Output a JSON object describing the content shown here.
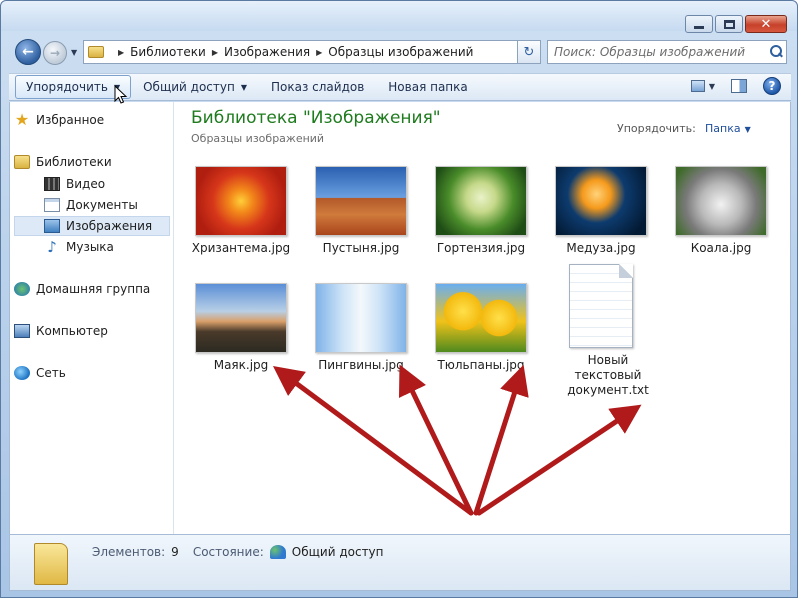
{
  "address": {
    "crumbs": [
      "Библиотеки",
      "Изображения",
      "Образцы изображений"
    ]
  },
  "search": {
    "placeholder": "Поиск: Образцы изображений"
  },
  "toolbar": {
    "organize": "Упорядочить",
    "share": "Общий доступ",
    "slideshow": "Показ слайдов",
    "new_folder": "Новая папка"
  },
  "nav": {
    "favorites": "Избранное",
    "libraries": "Библиотеки",
    "video": "Видео",
    "documents": "Документы",
    "images": "Изображения",
    "music": "Музыка",
    "homegroup": "Домашняя группа",
    "computer": "Компьютер",
    "network": "Сеть"
  },
  "library": {
    "title": "Библиотека \"Изображения\"",
    "subtitle": "Образцы изображений",
    "arrange_label": "Упорядочить:",
    "arrange_value": "Папка"
  },
  "files": [
    {
      "name": "Хризантема.jpg"
    },
    {
      "name": "Пустыня.jpg"
    },
    {
      "name": "Гортензия.jpg"
    },
    {
      "name": "Медуза.jpg"
    },
    {
      "name": "Коала.jpg"
    },
    {
      "name": "Маяк.jpg"
    },
    {
      "name": "Пингвины.jpg"
    },
    {
      "name": "Тюльпаны.jpg"
    },
    {
      "name": "Новый текстовый документ.txt"
    }
  ],
  "details": {
    "count_label": "Элементов:",
    "count_value": "9",
    "state_label": "Состояние:",
    "state_value": "Общий доступ"
  },
  "colors": {
    "title_green": "#1e7b1e",
    "annotation_arrow": "#b01a1a"
  }
}
